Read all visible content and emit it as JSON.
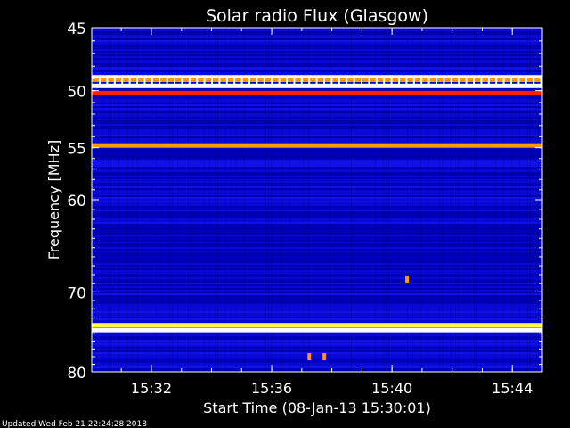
{
  "chart_data": {
    "type": "heatmap",
    "title": "Solar radio Flux (Glasgow)",
    "xlabel": "Start Time (08-Jan-13 15:30:01)",
    "ylabel": "Frequency [MHz]",
    "x_ticks": [
      "15:32",
      "15:36",
      "15:40",
      "15:44"
    ],
    "y_ticks": [
      "45",
      "50",
      "55",
      "60",
      "70",
      "80"
    ],
    "x_range": [
      "15:30:01",
      "15:45:00"
    ],
    "y_range": [
      45,
      80
    ],
    "ylim_scale": "log",
    "colors": {
      "background": "#0000c8",
      "interference_orange": "#ff9a00",
      "interference_yellow": "#ffff40",
      "interference_red": "#ff2000",
      "white": "#ffffff"
    },
    "interference_bands_mhz": [
      {
        "freq": 48.9,
        "color": "white"
      },
      {
        "freq": 49.1,
        "color": "interference_orange"
      },
      {
        "freq": 49.6,
        "color": "white"
      },
      {
        "freq": 50.2,
        "color": "interference_red"
      },
      {
        "freq": 54.8,
        "color": "interference_orange"
      },
      {
        "freq": 74.0,
        "color": "interference_yellow"
      },
      {
        "freq": 74.6,
        "color": "white"
      }
    ],
    "bursts": [
      {
        "time": "15:37:15",
        "freq": 78.0
      },
      {
        "time": "15:37:45",
        "freq": 78.0
      },
      {
        "time": "15:40:30",
        "freq": 68.5
      }
    ]
  },
  "footer": {
    "updated": "Updated Wed Feb 21 22:24:28 2018"
  }
}
